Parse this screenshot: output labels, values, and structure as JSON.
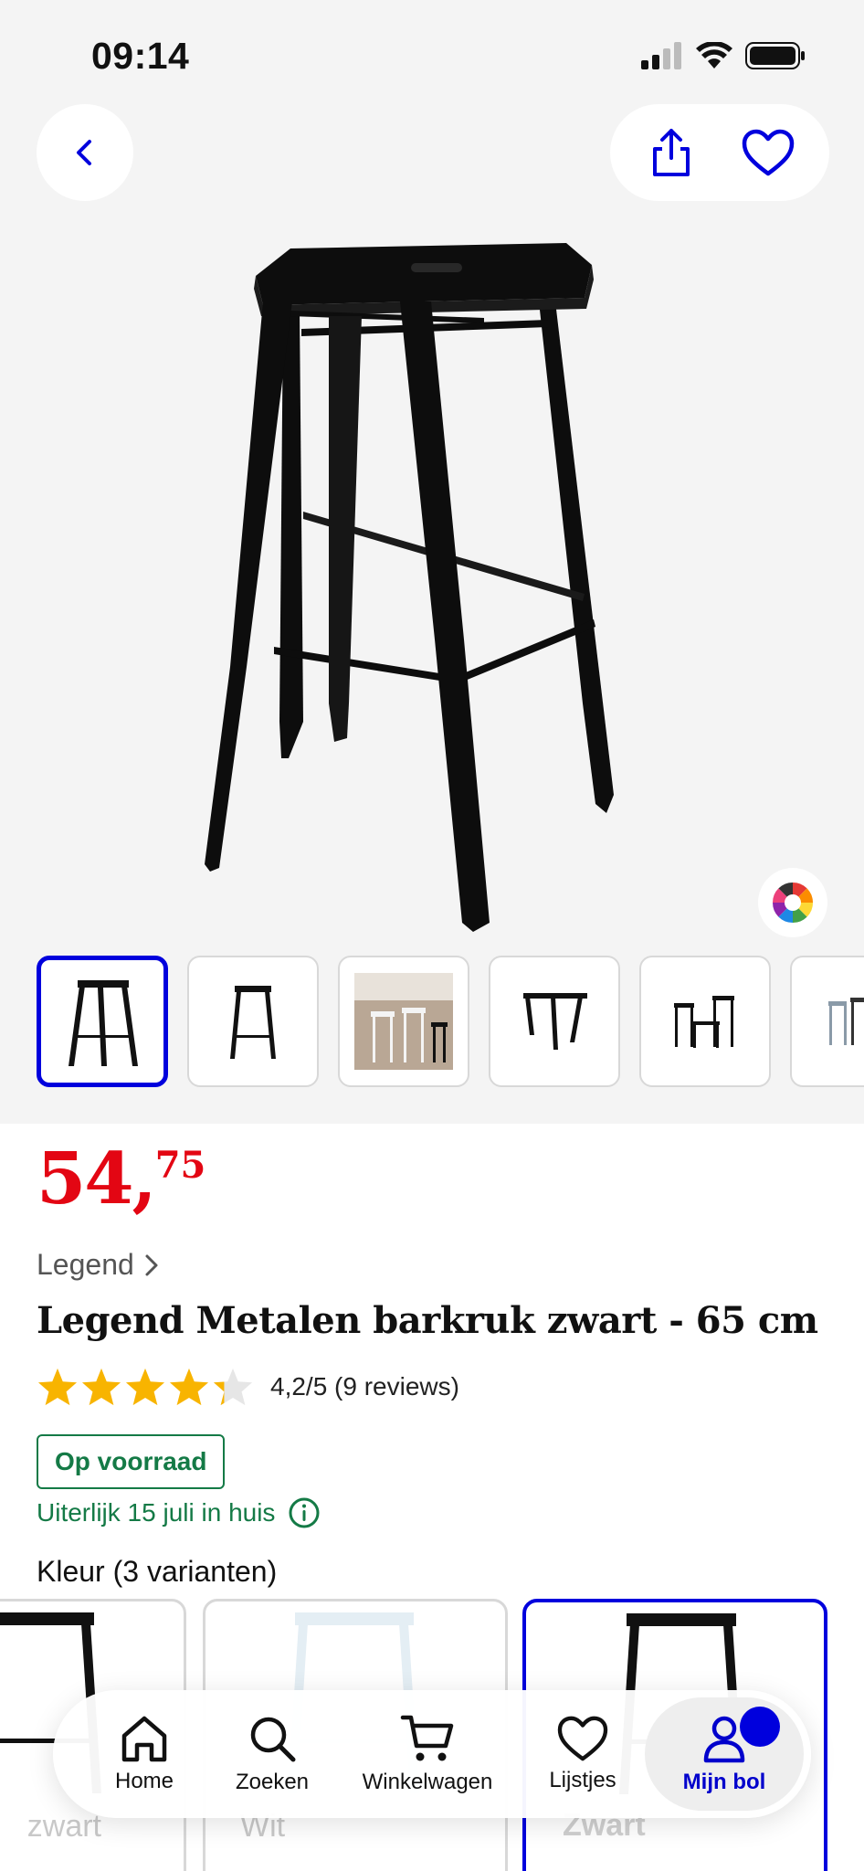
{
  "status": {
    "time": "09:14"
  },
  "product": {
    "price_main": "54,",
    "price_decimals": "75",
    "brand": "Legend",
    "title": "Legend Metalen barkruk zwart - 65 cm",
    "rating_text": "4,2/5 (9 reviews)",
    "rating_value": 4.2,
    "stock": "Op voorraad",
    "delivery": "Uiterlijk 15 juli in huis"
  },
  "variants": {
    "label": "Kleur (3 varianten)",
    "items": [
      {
        "name": "Zwart",
        "selected": false,
        "partial_name": "zwart"
      },
      {
        "name": "Wit",
        "selected": false
      },
      {
        "name": "Zwart",
        "selected": true
      }
    ]
  },
  "tabs": [
    {
      "label": "Home",
      "icon": "home-icon"
    },
    {
      "label": "Zoeken",
      "icon": "search-icon"
    },
    {
      "label": "Winkelwagen",
      "icon": "cart-icon"
    },
    {
      "label": "Lijstjes",
      "icon": "heart-icon"
    },
    {
      "label": "Mijn bol",
      "icon": "user-icon",
      "active": true
    }
  ],
  "colors": {
    "accent": "#0000dd",
    "price": "#e30613",
    "stock": "#147a46"
  }
}
